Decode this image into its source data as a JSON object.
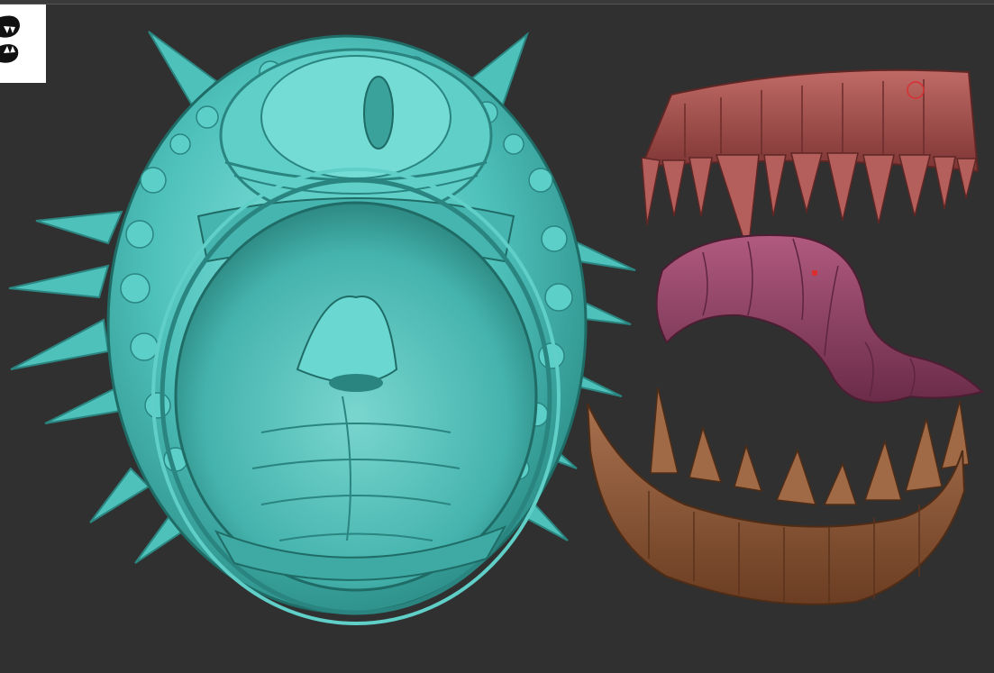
{
  "viewport": {
    "background": "#303030"
  },
  "logo": {
    "icon": "monster-jaw-logo-icon"
  },
  "subtools": [
    {
      "name": "head-mesh",
      "color": "#4fc1bb"
    },
    {
      "name": "upper-teeth-mesh",
      "color": "#a7514f"
    },
    {
      "name": "tongue-mesh",
      "color": "#8e3f61"
    },
    {
      "name": "lower-teeth-mesh",
      "color": "#8c5637"
    }
  ],
  "colors": {
    "head": "#4fc1bb",
    "head_dark": "#2b8580",
    "head_light": "#7fe0da",
    "upper_teeth": "#a7514f",
    "tongue": "#8e3f61",
    "lower_teeth": "#8c5637",
    "cursor": "#d83030"
  }
}
